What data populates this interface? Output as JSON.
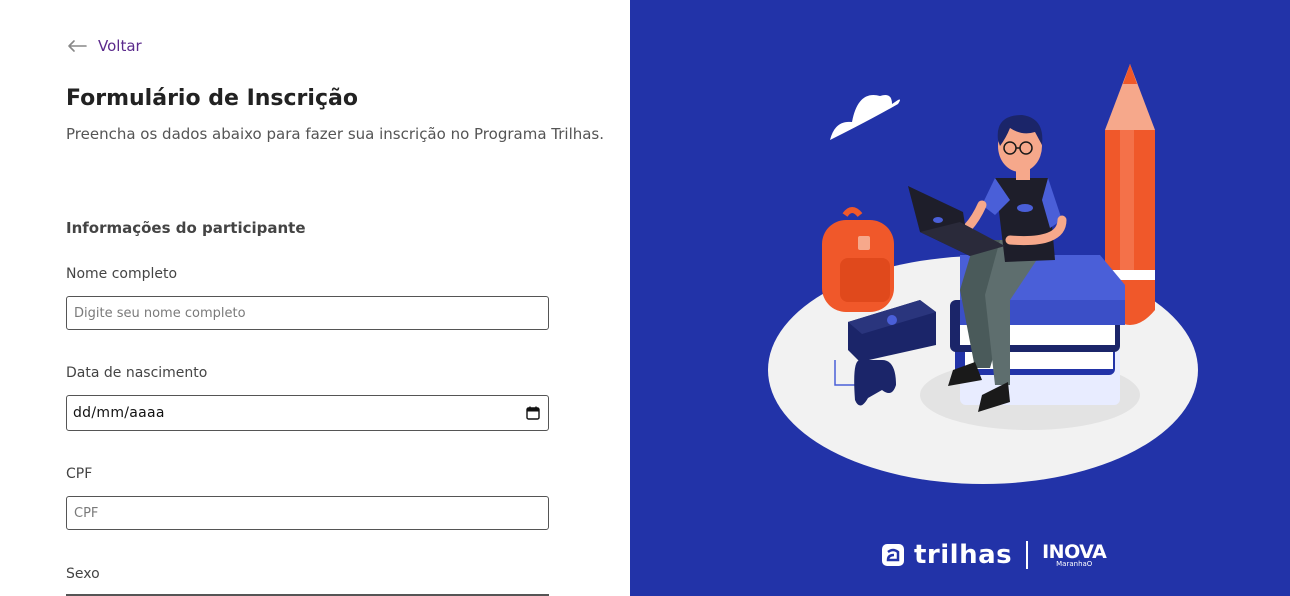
{
  "nav": {
    "back_label": "Voltar"
  },
  "form": {
    "title": "Formulário de Inscrição",
    "subtitle": "Preencha os dados abaixo para fazer sua inscrição no Programa Trilhas.",
    "section_title": "Informações do participante",
    "fields": {
      "name": {
        "label": "Nome completo",
        "placeholder": "Digite seu nome completo",
        "value": ""
      },
      "birthdate": {
        "label": "Data de nascimento",
        "value": "dd/mm/aaaa"
      },
      "cpf": {
        "label": "CPF",
        "placeholder": "CPF",
        "value": ""
      },
      "sex": {
        "label": "Sexo"
      }
    }
  },
  "brand": {
    "trilhas_text": "trilhas",
    "inova_text": "INOVA",
    "inova_sub": "MaranhaO"
  },
  "colors": {
    "panel_bg": "#2233a8",
    "back_link": "#5b2a8c",
    "accent_orange": "#f0582a"
  },
  "icons": {
    "back": "arrow-left-icon",
    "calendar": "calendar-icon",
    "illustration": "student-with-laptop-illustration"
  }
}
